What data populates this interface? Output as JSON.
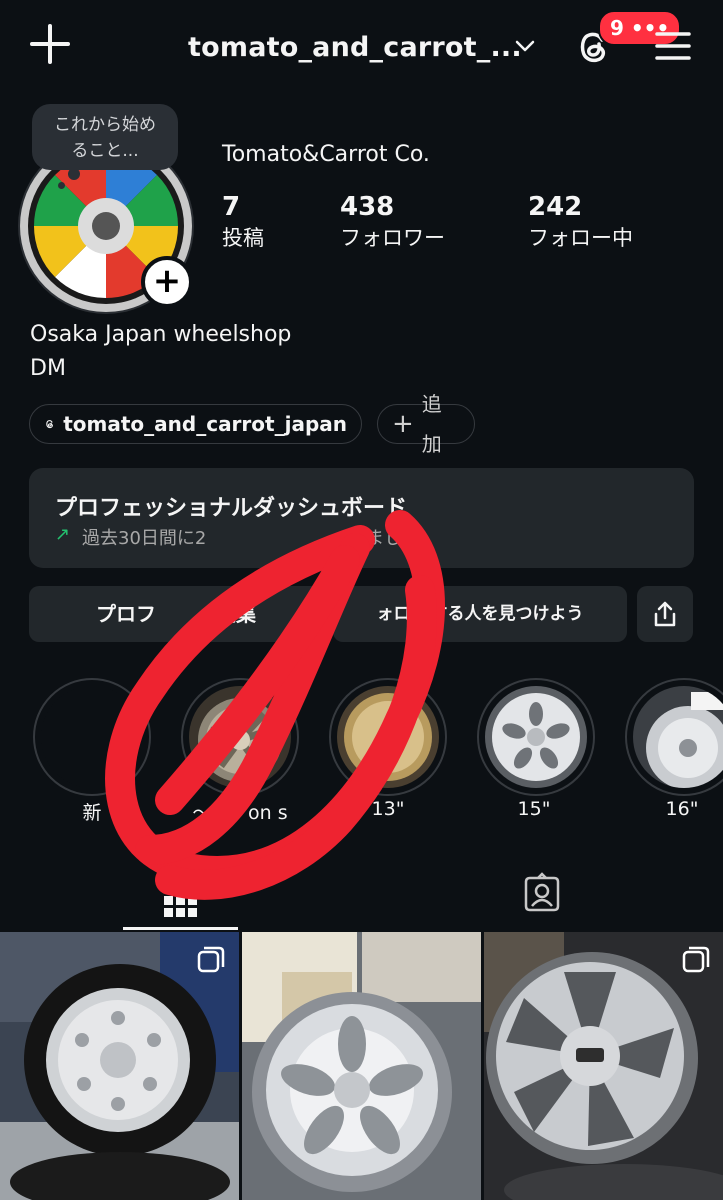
{
  "header": {
    "username": "tomato_and_carrot_...",
    "notif_count": "9 •••",
    "icons": [
      "plus-icon",
      "chevron-down-icon",
      "threads-icon",
      "menu-icon"
    ]
  },
  "note": {
    "text_line1": "これから始め",
    "text_line2": "ること..."
  },
  "profile": {
    "display_name": "Tomato&Carrot Co.",
    "stats": [
      {
        "value": "7",
        "label": "投稿"
      },
      {
        "value": "438",
        "label": "フォロワー"
      },
      {
        "value": "242",
        "label": "フォロー中"
      }
    ],
    "bio_line1": "Osaka Japan wheelshop",
    "bio_line2": "DM"
  },
  "links": {
    "threads_handle": "tomato_and_carrot_japan",
    "add_label": "追加"
  },
  "dashboard": {
    "title": "プロフェッショナルダッシュボード",
    "subtitle": "過去30日間に2",
    "subtitle_end": "ました。"
  },
  "actions": {
    "edit_profile_a": "プロフ",
    "edit_profile_b": "編集",
    "find_people_a": "ォロ",
    "find_people_b": "する人を見つけよう"
  },
  "highlights": [
    {
      "label": "新",
      "thumb": "wheel-light"
    },
    {
      "label": "～5/6 on s",
      "thumb": "wheel-gold-6spoke"
    },
    {
      "label": "13\"",
      "thumb": "wheel-gold-mesh"
    },
    {
      "label": "15\"",
      "thumb": "wheel-silver-5spoke"
    },
    {
      "label": "16\"",
      "thumb": "wheel-silver-label"
    }
  ],
  "tabs": [
    "grid-icon",
    "tagged-icon"
  ],
  "colors": {
    "background": "#0c1014",
    "surface": "#22272b",
    "badge": "#ff3040",
    "accent_green": "#24c16f",
    "scribble": "#ee2330"
  }
}
